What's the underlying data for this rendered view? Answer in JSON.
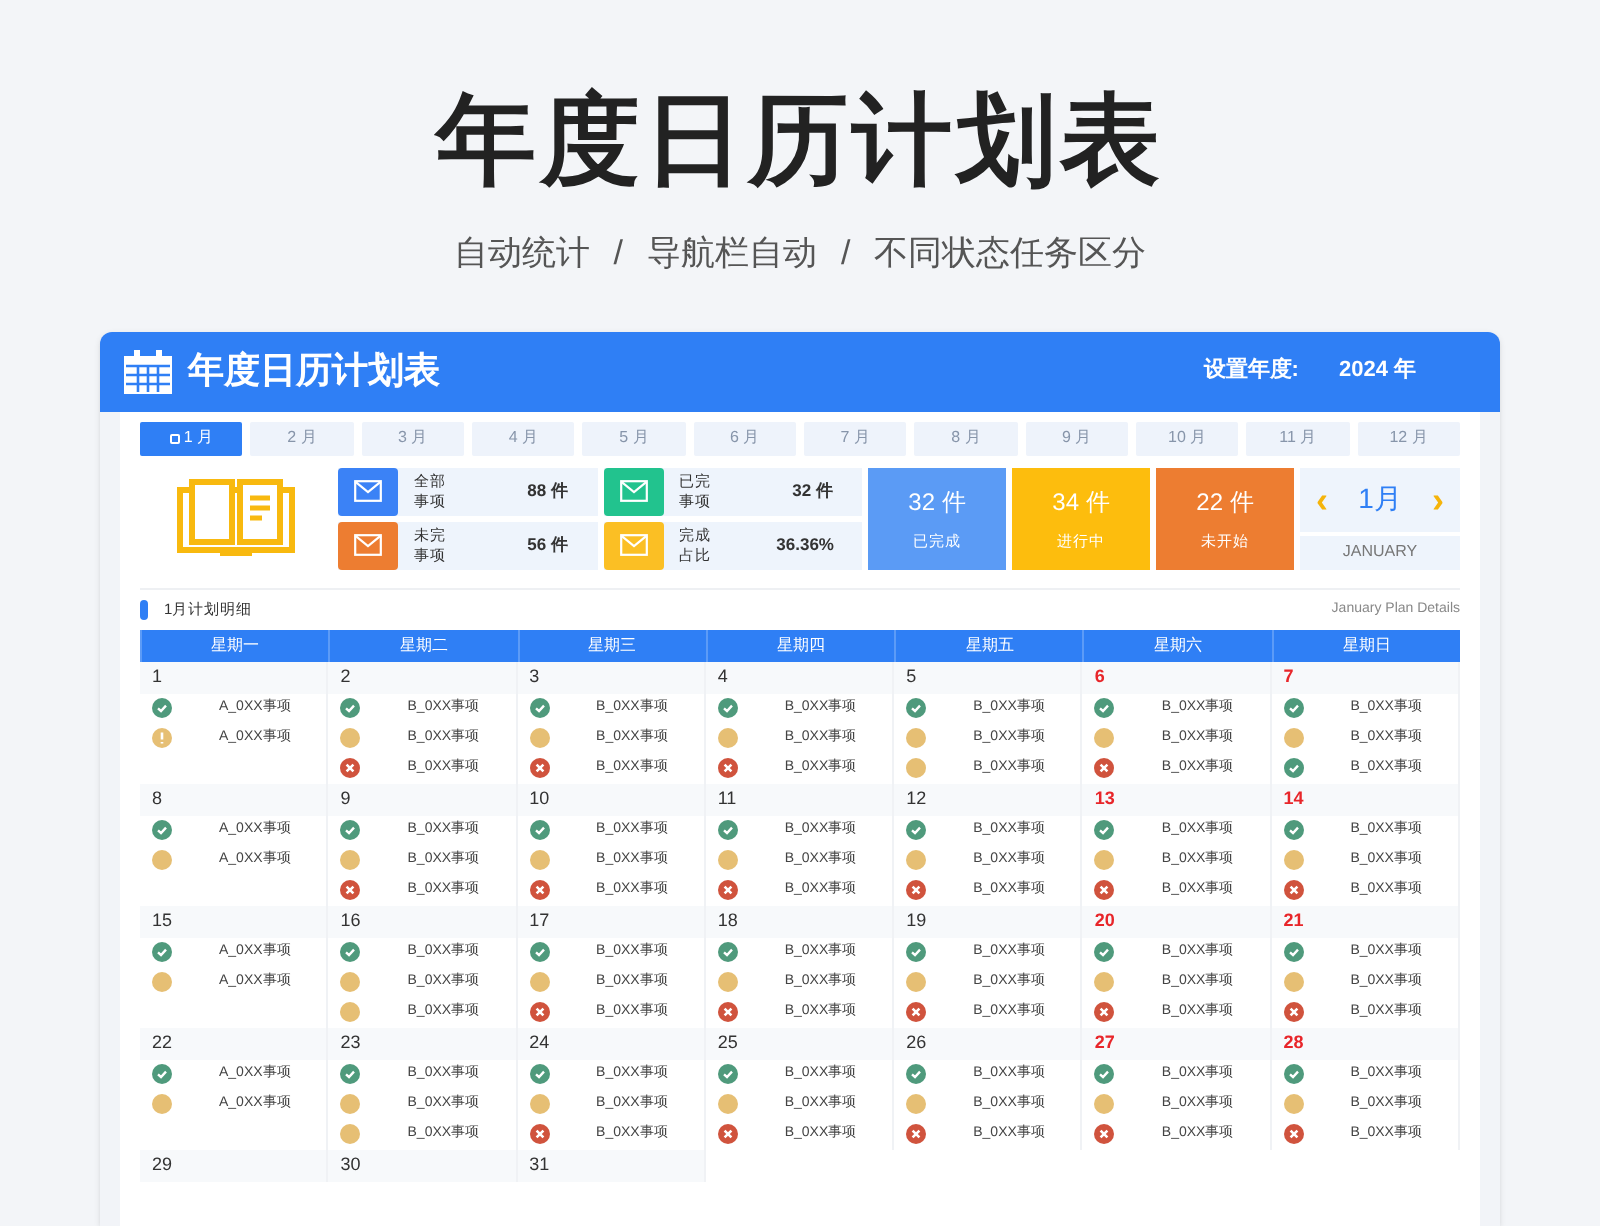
{
  "title": "年度日历计划表",
  "subtitle": [
    "自动统计",
    "/",
    "导航栏自动",
    "/",
    "不同状态任务区分"
  ],
  "header": {
    "title": "年度日历计划表",
    "year_label": "设置年度:",
    "year_value": "2024 年"
  },
  "tabs": [
    {
      "label": "1 月",
      "selected": true
    },
    {
      "label": "2 月",
      "selected": false
    },
    {
      "label": "3 月",
      "selected": false
    },
    {
      "label": "4 月",
      "selected": false
    },
    {
      "label": "5 月",
      "selected": false
    },
    {
      "label": "6 月",
      "selected": false
    },
    {
      "label": "7 月",
      "selected": false
    },
    {
      "label": "8 月",
      "selected": false
    },
    {
      "label": "9 月",
      "selected": false
    },
    {
      "label": "10 月",
      "selected": false
    },
    {
      "label": "11 月",
      "selected": false
    },
    {
      "label": "12 月",
      "selected": false
    }
  ],
  "stats": [
    {
      "label": "全部事项",
      "value": "88 件",
      "color": "#3b82f6"
    },
    {
      "label": "已完事项",
      "value": "32 件",
      "color": "#22c38e"
    },
    {
      "label": "未完事项",
      "value": "56 件",
      "color": "#ed7d31"
    },
    {
      "label": "完成占比",
      "value": "36.36%",
      "color": "#fbbf24"
    }
  ],
  "summary": [
    {
      "value": "32 件",
      "label": "已完成",
      "color": "#5b9bf5"
    },
    {
      "value": "34 件",
      "label": "进行中",
      "color": "#fdbd0d"
    },
    {
      "value": "22 件",
      "label": "未开始",
      "color": "#ed7d31"
    }
  ],
  "month_nav": {
    "prev": "‹",
    "month": "1月",
    "next": "›",
    "english": "JANUARY"
  },
  "section": {
    "title": "1月计划明细",
    "subtitle": "January Plan Details"
  },
  "weekdays": [
    "星期一",
    "星期二",
    "星期三",
    "星期四",
    "星期五",
    "星期六",
    "星期日"
  ],
  "weeks": [
    [
      {
        "day": "1",
        "holiday": false,
        "items": [
          {
            "kind": "done",
            "label": "A_0XX事项"
          },
          {
            "kind": "warning",
            "label": "A_0XX事项"
          }
        ]
      },
      {
        "day": "2",
        "holiday": false,
        "items": [
          {
            "kind": "done",
            "label": "B_0XX事项"
          },
          {
            "kind": "pending",
            "label": "B_0XX事项"
          },
          {
            "kind": "cancelled",
            "label": "B_0XX事项"
          }
        ]
      },
      {
        "day": "3",
        "holiday": false,
        "items": [
          {
            "kind": "done",
            "label": "B_0XX事项"
          },
          {
            "kind": "pending",
            "label": "B_0XX事项"
          },
          {
            "kind": "cancelled",
            "label": "B_0XX事项"
          }
        ]
      },
      {
        "day": "4",
        "holiday": false,
        "items": [
          {
            "kind": "done",
            "label": "B_0XX事项"
          },
          {
            "kind": "pending",
            "label": "B_0XX事项"
          },
          {
            "kind": "cancelled",
            "label": "B_0XX事项"
          }
        ]
      },
      {
        "day": "5",
        "holiday": false,
        "items": [
          {
            "kind": "done",
            "label": "B_0XX事项"
          },
          {
            "kind": "pending",
            "label": "B_0XX事项"
          },
          {
            "kind": "pending",
            "label": "B_0XX事项"
          }
        ]
      },
      {
        "day": "6",
        "holiday": true,
        "items": [
          {
            "kind": "done",
            "label": "B_0XX事项"
          },
          {
            "kind": "pending",
            "label": "B_0XX事项"
          },
          {
            "kind": "cancelled",
            "label": "B_0XX事项"
          }
        ]
      },
      {
        "day": "7",
        "holiday": true,
        "items": [
          {
            "kind": "done",
            "label": "B_0XX事项"
          },
          {
            "kind": "pending",
            "label": "B_0XX事项"
          },
          {
            "kind": "done",
            "label": "B_0XX事项"
          }
        ]
      }
    ],
    [
      {
        "day": "8",
        "holiday": false,
        "items": [
          {
            "kind": "done",
            "label": "A_0XX事项"
          },
          {
            "kind": "pending",
            "label": "A_0XX事项"
          }
        ]
      },
      {
        "day": "9",
        "holiday": false,
        "items": [
          {
            "kind": "done",
            "label": "B_0XX事项"
          },
          {
            "kind": "pending",
            "label": "B_0XX事项"
          },
          {
            "kind": "cancelled",
            "label": "B_0XX事项"
          }
        ]
      },
      {
        "day": "10",
        "holiday": false,
        "items": [
          {
            "kind": "done",
            "label": "B_0XX事项"
          },
          {
            "kind": "pending",
            "label": "B_0XX事项"
          },
          {
            "kind": "cancelled",
            "label": "B_0XX事项"
          }
        ]
      },
      {
        "day": "11",
        "holiday": false,
        "items": [
          {
            "kind": "done",
            "label": "B_0XX事项"
          },
          {
            "kind": "pending",
            "label": "B_0XX事项"
          },
          {
            "kind": "cancelled",
            "label": "B_0XX事项"
          }
        ]
      },
      {
        "day": "12",
        "holiday": false,
        "items": [
          {
            "kind": "done",
            "label": "B_0XX事项"
          },
          {
            "kind": "pending",
            "label": "B_0XX事项"
          },
          {
            "kind": "cancelled",
            "label": "B_0XX事项"
          }
        ]
      },
      {
        "day": "13",
        "holiday": true,
        "items": [
          {
            "kind": "done",
            "label": "B_0XX事项"
          },
          {
            "kind": "pending",
            "label": "B_0XX事项"
          },
          {
            "kind": "cancelled",
            "label": "B_0XX事项"
          }
        ]
      },
      {
        "day": "14",
        "holiday": true,
        "items": [
          {
            "kind": "done",
            "label": "B_0XX事项"
          },
          {
            "kind": "pending",
            "label": "B_0XX事项"
          },
          {
            "kind": "cancelled",
            "label": "B_0XX事项"
          }
        ]
      }
    ],
    [
      {
        "day": "15",
        "holiday": false,
        "items": [
          {
            "kind": "done",
            "label": "A_0XX事项"
          },
          {
            "kind": "pending",
            "label": "A_0XX事项"
          }
        ]
      },
      {
        "day": "16",
        "holiday": false,
        "items": [
          {
            "kind": "done",
            "label": "B_0XX事项"
          },
          {
            "kind": "pending",
            "label": "B_0XX事项"
          },
          {
            "kind": "pending",
            "label": "B_0XX事项"
          }
        ]
      },
      {
        "day": "17",
        "holiday": false,
        "items": [
          {
            "kind": "done",
            "label": "B_0XX事项"
          },
          {
            "kind": "pending",
            "label": "B_0XX事项"
          },
          {
            "kind": "cancelled",
            "label": "B_0XX事项"
          }
        ]
      },
      {
        "day": "18",
        "holiday": false,
        "items": [
          {
            "kind": "done",
            "label": "B_0XX事项"
          },
          {
            "kind": "pending",
            "label": "B_0XX事项"
          },
          {
            "kind": "cancelled",
            "label": "B_0XX事项"
          }
        ]
      },
      {
        "day": "19",
        "holiday": false,
        "items": [
          {
            "kind": "done",
            "label": "B_0XX事项"
          },
          {
            "kind": "pending",
            "label": "B_0XX事项"
          },
          {
            "kind": "cancelled",
            "label": "B_0XX事项"
          }
        ]
      },
      {
        "day": "20",
        "holiday": true,
        "items": [
          {
            "kind": "done",
            "label": "B_0XX事项"
          },
          {
            "kind": "pending",
            "label": "B_0XX事项"
          },
          {
            "kind": "cancelled",
            "label": "B_0XX事项"
          }
        ]
      },
      {
        "day": "21",
        "holiday": true,
        "items": [
          {
            "kind": "done",
            "label": "B_0XX事项"
          },
          {
            "kind": "pending",
            "label": "B_0XX事项"
          },
          {
            "kind": "cancelled",
            "label": "B_0XX事项"
          }
        ]
      }
    ],
    [
      {
        "day": "22",
        "holiday": false,
        "items": [
          {
            "kind": "done",
            "label": "A_0XX事项"
          },
          {
            "kind": "pending",
            "label": "A_0XX事项"
          }
        ]
      },
      {
        "day": "23",
        "holiday": false,
        "items": [
          {
            "kind": "done",
            "label": "B_0XX事项"
          },
          {
            "kind": "pending",
            "label": "B_0XX事项"
          },
          {
            "kind": "pending",
            "label": "B_0XX事项"
          }
        ]
      },
      {
        "day": "24",
        "holiday": false,
        "items": [
          {
            "kind": "done",
            "label": "B_0XX事项"
          },
          {
            "kind": "pending",
            "label": "B_0XX事项"
          },
          {
            "kind": "cancelled",
            "label": "B_0XX事项"
          }
        ]
      },
      {
        "day": "25",
        "holiday": false,
        "items": [
          {
            "kind": "done",
            "label": "B_0XX事项"
          },
          {
            "kind": "pending",
            "label": "B_0XX事项"
          },
          {
            "kind": "cancelled",
            "label": "B_0XX事项"
          }
        ]
      },
      {
        "day": "26",
        "holiday": false,
        "items": [
          {
            "kind": "done",
            "label": "B_0XX事项"
          },
          {
            "kind": "pending",
            "label": "B_0XX事项"
          },
          {
            "kind": "cancelled",
            "label": "B_0XX事项"
          }
        ]
      },
      {
        "day": "27",
        "holiday": true,
        "items": [
          {
            "kind": "done",
            "label": "B_0XX事项"
          },
          {
            "kind": "pending",
            "label": "B_0XX事项"
          },
          {
            "kind": "cancelled",
            "label": "B_0XX事项"
          }
        ]
      },
      {
        "day": "28",
        "holiday": true,
        "items": [
          {
            "kind": "done",
            "label": "B_0XX事项"
          },
          {
            "kind": "pending",
            "label": "B_0XX事项"
          },
          {
            "kind": "cancelled",
            "label": "B_0XX事项"
          }
        ]
      }
    ],
    [
      {
        "day": "29",
        "holiday": false
      },
      {
        "day": "30",
        "holiday": false
      },
      {
        "day": "31",
        "holiday": false
      }
    ]
  ]
}
